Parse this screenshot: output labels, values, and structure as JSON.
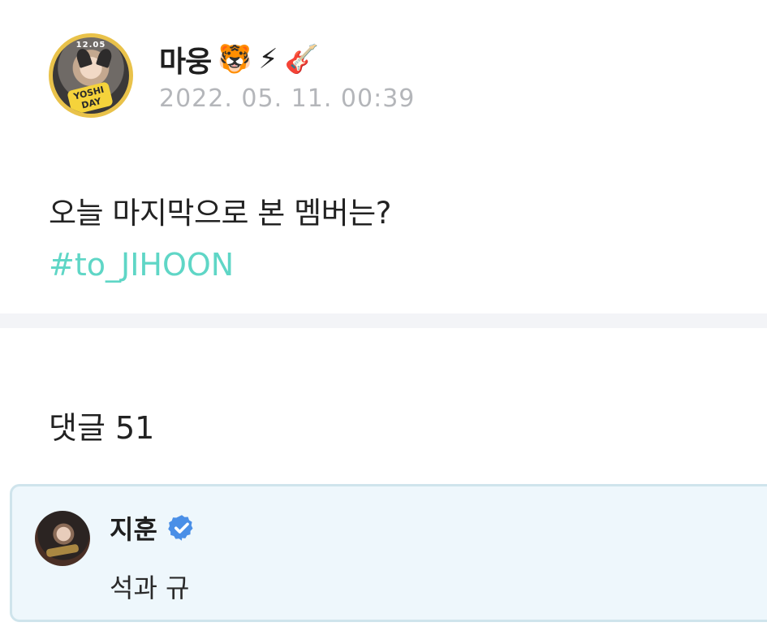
{
  "post": {
    "author": {
      "name": "마웅",
      "emojis": [
        "🐯",
        "⚡",
        "🎸"
      ],
      "avatar_badge_top": "12.05",
      "avatar_sticker": "YOSHI DAY"
    },
    "timestamp": "2022. 05. 11. 00:39",
    "body": "오늘 마지막으로 본 멤버는?",
    "hashtag": "#to_JIHOON"
  },
  "comments": {
    "title": "댓글 51",
    "items": [
      {
        "author": "지훈",
        "verified": true,
        "text": "석과 규"
      }
    ]
  },
  "colors": {
    "hashtag": "#5fd6c6",
    "timestamp": "#b4b6ba",
    "comment_bg": "#eef7fc",
    "comment_border": "#cfe4ec",
    "verified_badge": "#4a8fe7"
  }
}
